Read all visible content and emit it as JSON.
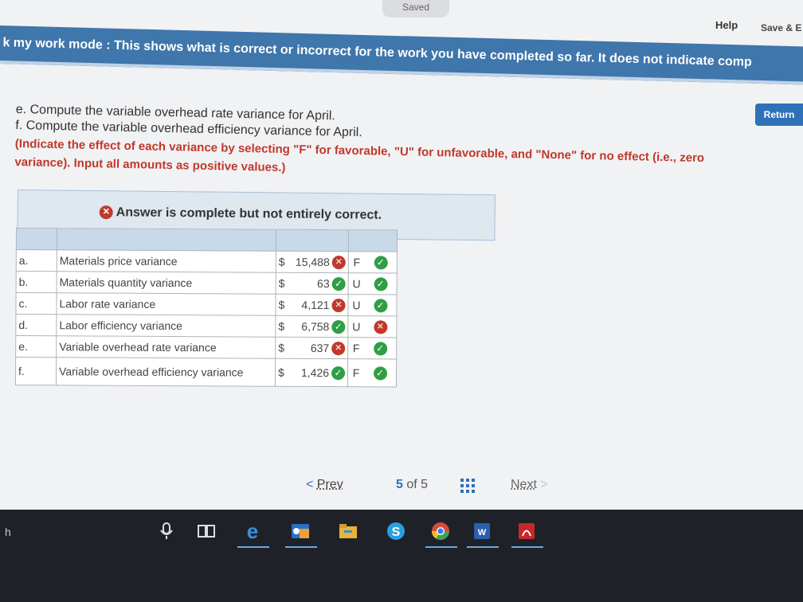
{
  "header": {
    "saved_label": "Saved",
    "help_label": "Help",
    "save_exit_label": "Save & E"
  },
  "banner": {
    "text": "k my work mode : This shows what is correct or incorrect for the work you have completed so far. It does not indicate comp"
  },
  "return_label": "Return",
  "question": {
    "line_e": "e. Compute the variable overhead rate variance for April.",
    "line_f": "f. Compute the variable overhead efficiency variance for April.",
    "hint_1": "(Indicate the effect of each variance by selecting \"F\" for favorable, \"U\" for unfavorable, and \"None\" for no effect (i.e., zero",
    "hint_2": "variance). Input all amounts as positive values.)"
  },
  "answer_status": "Answer is complete but not entirely correct.",
  "rows": [
    {
      "letter": "a.",
      "desc": "Materials price variance",
      "currency": "$",
      "amount": "15,488",
      "amount_ok": false,
      "effect": "F",
      "effect_ok": true
    },
    {
      "letter": "b.",
      "desc": "Materials quantity variance",
      "currency": "$",
      "amount": "63",
      "amount_ok": true,
      "effect": "U",
      "effect_ok": true
    },
    {
      "letter": "c.",
      "desc": "Labor rate variance",
      "currency": "$",
      "amount": "4,121",
      "amount_ok": false,
      "effect": "U",
      "effect_ok": true
    },
    {
      "letter": "d.",
      "desc": "Labor efficiency variance",
      "currency": "$",
      "amount": "6,758",
      "amount_ok": true,
      "effect": "U",
      "effect_ok": false
    },
    {
      "letter": "e.",
      "desc": "Variable overhead rate variance",
      "currency": "$",
      "amount": "637",
      "amount_ok": false,
      "effect": "F",
      "effect_ok": true
    },
    {
      "letter": "f.",
      "desc": "Variable overhead efficiency variance",
      "currency": "$",
      "amount": "1,426",
      "amount_ok": true,
      "effect": "F",
      "effect_ok": true
    }
  ],
  "pager": {
    "prev_label": "Prev",
    "current": "5",
    "of_label": "of",
    "total": "5",
    "next_label": "Next"
  },
  "taskbar": {
    "left_text": "h",
    "icons": [
      "microphone-icon",
      "task-view-icon",
      "edge-icon",
      "outlook-icon",
      "file-explorer-icon",
      "skype-icon",
      "chrome-icon",
      "word-icon",
      "acrobat-icon"
    ]
  },
  "colors": {
    "banner": "#3f76ab",
    "correct": "#2f9e44",
    "incorrect": "#c0392b",
    "link": "#2f71b7"
  }
}
